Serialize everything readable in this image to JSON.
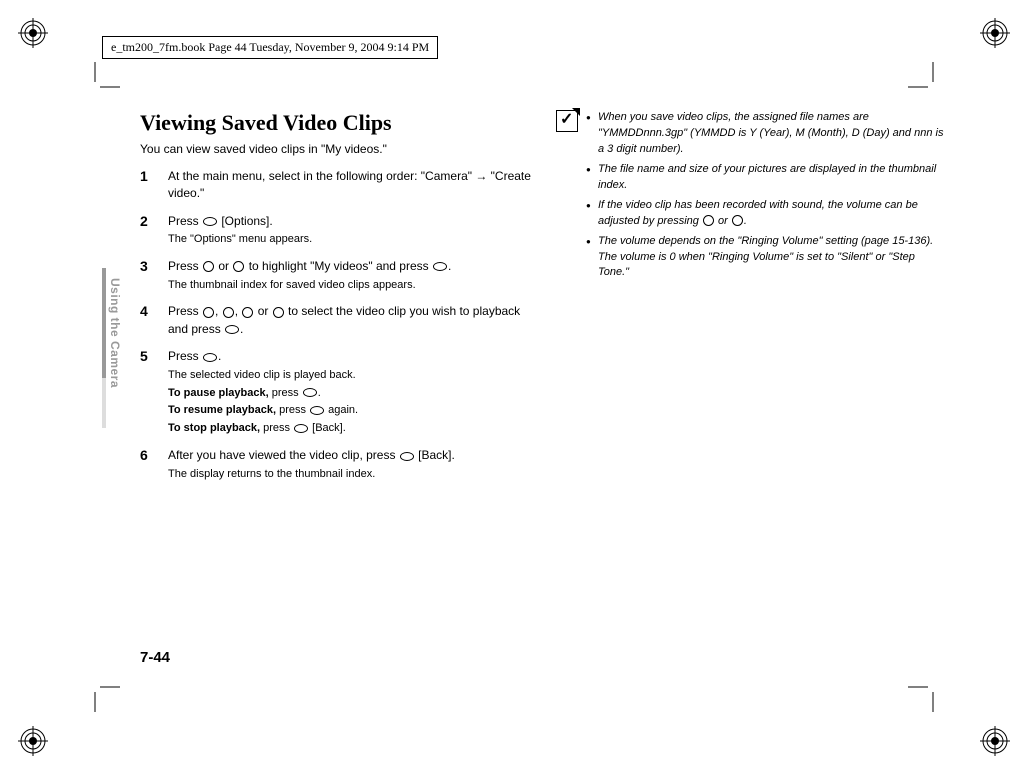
{
  "header_line": "e_tm200_7fm.book  Page 44  Tuesday, November 9, 2004  9:14 PM",
  "side_label": "Using the Camera",
  "title": "Viewing Saved Video Clips",
  "intro": "You can view saved video clips in \"My videos.\"",
  "steps": {
    "s1": {
      "num": "1",
      "body": "At the main menu, select in the following order: \"Camera\" → \"Create video.\""
    },
    "s2": {
      "num": "2",
      "body_pre": "Press ",
      "body_post": " [Options].",
      "sub": "The \"Options\" menu appears."
    },
    "s3": {
      "num": "3",
      "body_pre": "Press ",
      "body_mid": " or ",
      "body_post1": " to highlight \"My videos\" and press ",
      "body_post2": ".",
      "sub": "The thumbnail index for saved video clips appears."
    },
    "s4": {
      "num": "4",
      "body_pre": "Press ",
      "sep": ", ",
      "body_or": " or ",
      "body_post1": " to select the video clip you wish to playback and press ",
      "body_post2": "."
    },
    "s5": {
      "num": "5",
      "body_pre": "Press ",
      "body_post": ".",
      "sub1": "The selected video clip is played back.",
      "pause_label": "To pause playback,",
      "pause_rest": " press ",
      "pause_end": ".",
      "resume_label": "To resume playback,",
      "resume_rest": " press ",
      "resume_end": " again.",
      "stop_label": "To stop playback,",
      "stop_rest": " press ",
      "stop_end": " [Back]."
    },
    "s6": {
      "num": "6",
      "body_pre": "After you have viewed the video clip, press ",
      "body_post": " [Back].",
      "sub": "The display returns to the thumbnail index."
    }
  },
  "notes": {
    "n1": "When you save video clips, the assigned file names are \"YMMDDnnn.3gp\" (YMMDD is Y (Year), M (Month), D (Day) and nnn is a 3 digit number).",
    "n2": "The file name and size of your pictures are displayed in the thumbnail index.",
    "n3_pre": "If the video clip has been recorded with sound, the volume can be adjusted by pressing ",
    "n3_mid": " or ",
    "n3_post": ".",
    "n4": "The volume depends on the \"Ringing Volume\" setting (page 15-136). The volume is 0 when \"Ringing Volume\" is set to \"Silent\" or \"Step Tone.\""
  },
  "page_num": "7-44"
}
